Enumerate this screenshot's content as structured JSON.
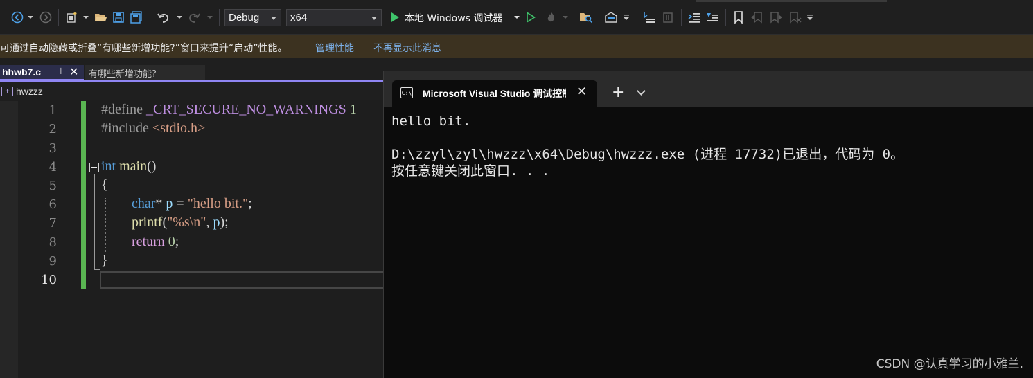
{
  "toolbar": {
    "config": "Debug",
    "platform": "x64",
    "run_label": "本地 Windows 调试器"
  },
  "infobar": {
    "message": "可通过自动隐藏或折叠“有哪些新增功能?”窗口来提升“启动”性能。",
    "link_manage": "管理性能",
    "link_dismiss": "不再显示此消息"
  },
  "tabs": {
    "active": "hhwb7.c",
    "inactive": "有哪些新增功能?"
  },
  "navbar": {
    "project": "hwzzz"
  },
  "editor": {
    "line_numbers": [
      "1",
      "2",
      "3",
      "4",
      "5",
      "6",
      "7",
      "8",
      "9",
      "10"
    ],
    "current_line": "10",
    "code": {
      "l1_pre": "#define ",
      "l1_macro": "_CRT_SECURE_NO_WARNINGS",
      "l1_num": " 1",
      "l2_pre": "#include ",
      "l2_hdr": "<stdio.h>",
      "l4_kw": "int",
      "l4_fn": " main",
      "l4_rest": "()",
      "l5": "{",
      "l6_kw": "char",
      "l6_op": "* ",
      "l6_var": "p",
      "l6_eq": " = ",
      "l6_str": "\"hello bit.\"",
      "l6_end": ";",
      "l7_fn": "printf",
      "l7_open": "(",
      "l7_str": "\"%s\\n\"",
      "l7_comma": ", ",
      "l7_var": "p",
      "l7_end": ");",
      "l8_kw": "return",
      "l8_num": " 0",
      "l8_end": ";",
      "l9": "}"
    }
  },
  "console": {
    "title": "Microsoft Visual Studio 调试控制台",
    "lines": [
      "hello bit.",
      "",
      "D:\\zzyl\\zyl\\hwzzz\\x64\\Debug\\hwzzz.exe (进程 17732)已退出，代码为 0。",
      "按任意键关闭此窗口. . ."
    ]
  },
  "watermark": "CSDN @认真学习的小雅兰.",
  "icons": [
    "back-icon",
    "forward-icon",
    "new-project-icon",
    "open-folder-icon",
    "save-icon",
    "save-all-icon",
    "undo-icon",
    "redo-icon",
    "play-icon",
    "start-without-debug-icon",
    "hot-reload-icon",
    "solution-explorer-icon",
    "bookmark-icon"
  ],
  "colors": {
    "accent": "#8f85f2",
    "infobar": "#3c3220",
    "change_bar": "#5ab552"
  }
}
